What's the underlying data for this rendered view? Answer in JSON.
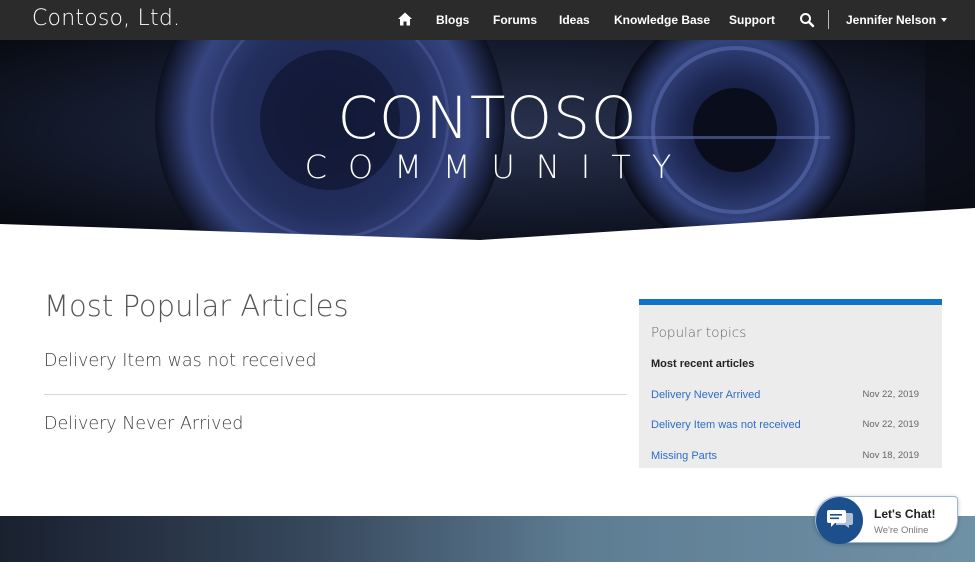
{
  "nav": {
    "brand": "Contoso, Ltd.",
    "home_icon": "home-icon",
    "links": [
      "Blogs",
      "Forums",
      "Ideas",
      "Knowledge Base",
      "Support"
    ],
    "search_icon": "search-icon",
    "user": "Jennifer Nelson"
  },
  "hero": {
    "title": "CONTOSO",
    "subtitle": "COMMUNITY"
  },
  "main": {
    "heading": "Most Popular Articles",
    "articles": [
      "Delivery Item was not received",
      "Delivery Never Arrived"
    ]
  },
  "sidebar": {
    "title": "Popular topics",
    "subtitle": "Most recent articles",
    "items": [
      {
        "label": "Delivery Never Arrived",
        "date": "Nov 22, 2019"
      },
      {
        "label": "Delivery Item was not received",
        "date": "Nov 22, 2019"
      },
      {
        "label": "Missing Parts",
        "date": "Nov 18, 2019"
      }
    ]
  },
  "chat": {
    "title": "Let's Chat!",
    "status": "We're Online",
    "icon": "chat-bubbles-icon"
  },
  "colors": {
    "nav_bg": "#2b2b2b",
    "accent": "#0f74c8",
    "link": "#2f6cc8",
    "chat": "#1d4f8d"
  }
}
